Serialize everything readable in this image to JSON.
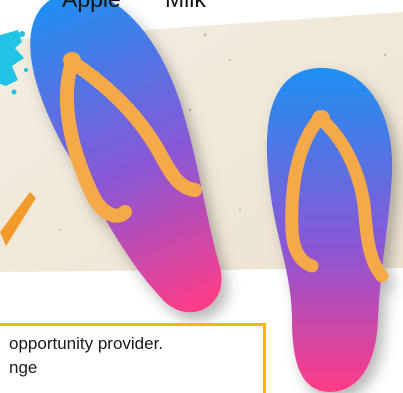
{
  "labels": {
    "apple": "Apple",
    "milk": "Milk"
  },
  "info_box": {
    "line1": "opportunity provider.",
    "line2": "nge"
  },
  "colors": {
    "sand": "#f1eadb",
    "sandal_top": "#2a8cf0",
    "sandal_bottom": "#ff3f8a",
    "strap": "#f6a94a",
    "box_border": "#f5b800",
    "paint_splash": "#22c3e6",
    "starfish": "#f39a2b"
  },
  "icons": {
    "left_sandal": "flip-flop-icon",
    "right_sandal": "flip-flop-icon",
    "splash": "paint-splash-icon",
    "starfish": "starfish-icon"
  }
}
